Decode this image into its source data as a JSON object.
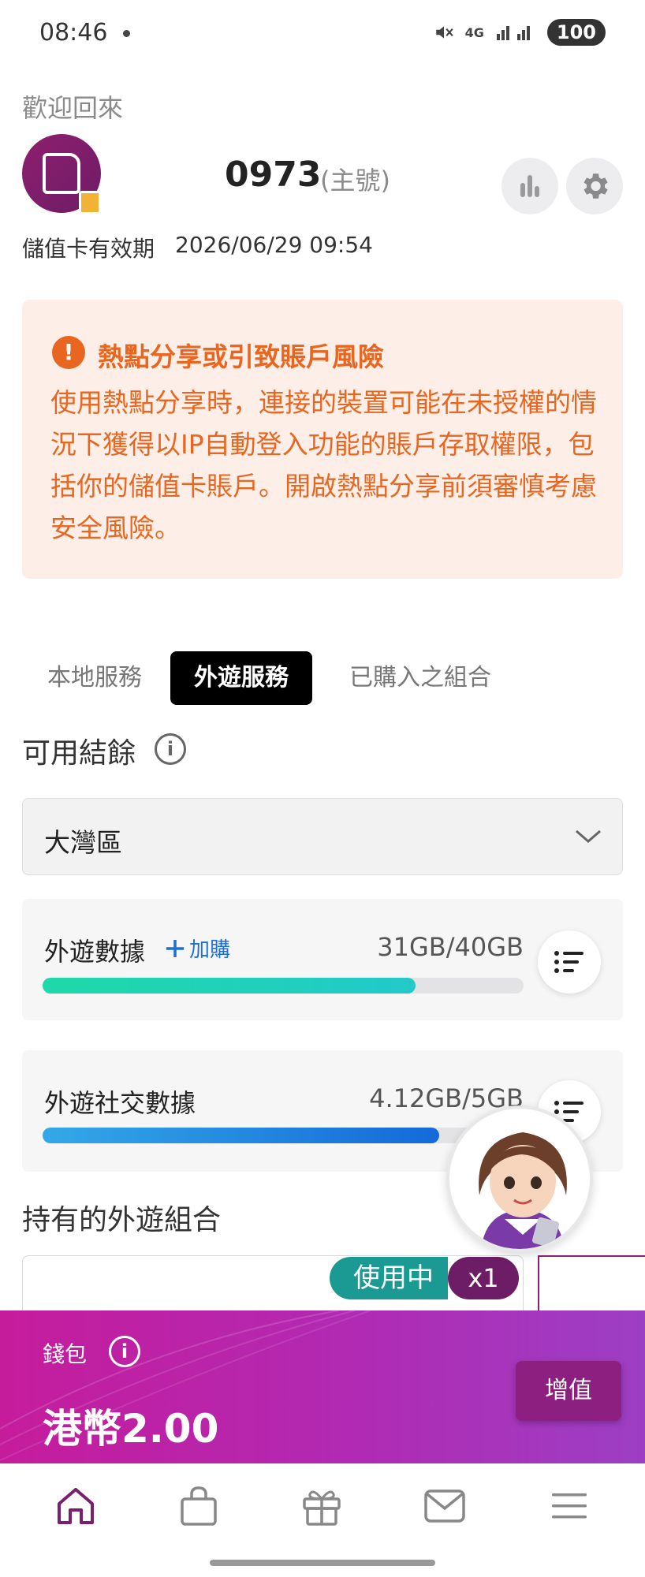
{
  "status_bar": {
    "time": "08:46",
    "battery": "100",
    "network": "4G"
  },
  "header": {
    "welcome": "歡迎回來",
    "phone_number": "0973",
    "phone_type": "(主號)",
    "validity_label": "儲值卡有效期",
    "validity_value": "2026/06/29 09:54"
  },
  "warning": {
    "title": "熱點分享或引致賬戶風險",
    "body": "使用熱點分享時，連接的裝置可能在未授權的情況下獲得以IP自動登入功能的賬戶存取權限，包括你的儲值卡賬戶。開啟熱點分享前須審慎考慮安全風險。"
  },
  "tabs": [
    {
      "label": "本地服務",
      "active": false
    },
    {
      "label": "外遊服務",
      "active": true
    },
    {
      "label": "已購入之組合",
      "active": false
    }
  ],
  "balance": {
    "title": "可用結餘",
    "region": "大灣區",
    "items": [
      {
        "label": "外遊數據",
        "addon": "加購",
        "value": "31GB/40GB",
        "fraction": 0.775
      },
      {
        "label": "外遊社交數據",
        "value": "4.12GB/5GB",
        "fraction": 0.824
      }
    ]
  },
  "held": {
    "title": "持有的外遊組合",
    "status": "使用中",
    "count": "x1"
  },
  "wallet": {
    "label": "錢包",
    "amount": "港幣2.00",
    "topup": "增值"
  },
  "colors": {
    "brand": "#8e1f6e",
    "warning": "#e8661f",
    "teal": "#1a9a93",
    "wallet": "#c51c9c"
  },
  "nav": [
    "home-icon",
    "shopping-bag-icon",
    "gift-icon",
    "mail-icon",
    "menu-icon"
  ]
}
